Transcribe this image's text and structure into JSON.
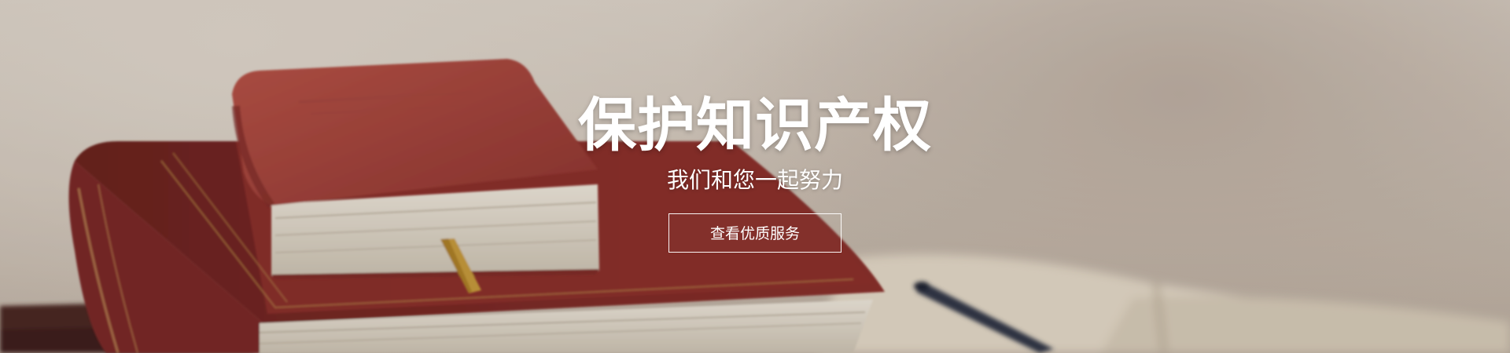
{
  "hero": {
    "title": "保护知识产权",
    "subtitle": "我们和您一起努力",
    "cta_label": "查看优质服务"
  },
  "colors": {
    "text": "#ffffff",
    "book_red": "#9b3f38",
    "book_red_dark": "#6d2420",
    "pages": "#e9e2d3",
    "bookmark": "#c89b3a",
    "pen": "#2f3446"
  },
  "icons": {
    "scene": "books-and-pen-illustration"
  }
}
